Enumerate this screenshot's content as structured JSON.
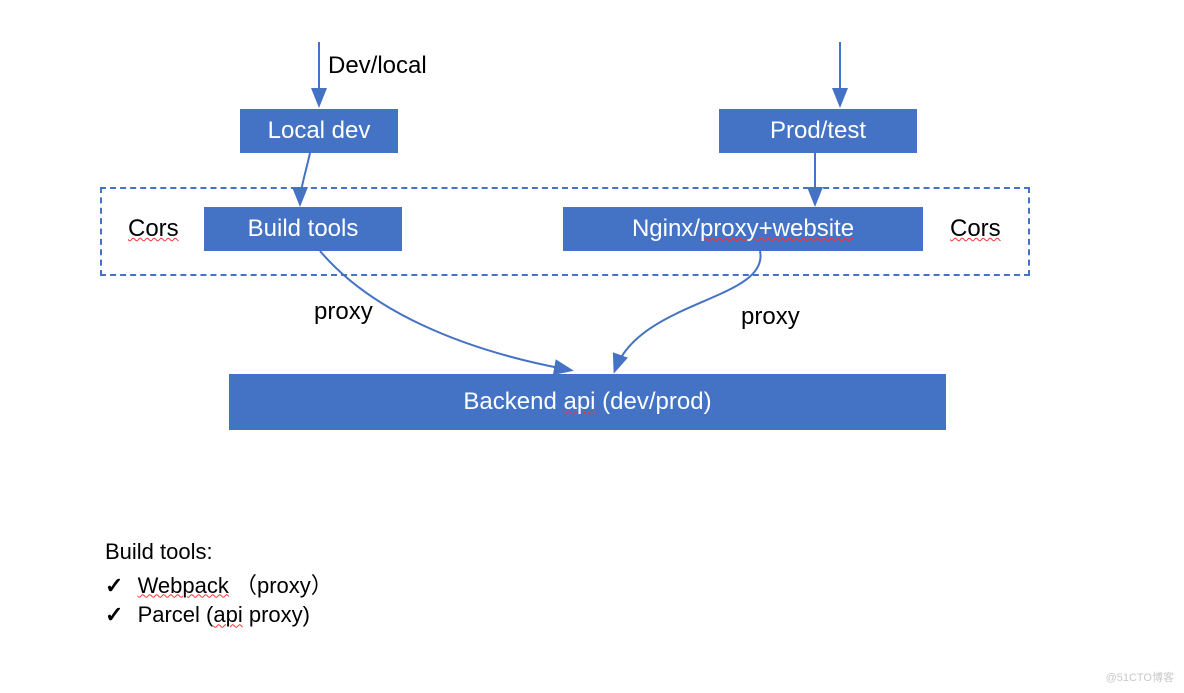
{
  "labels": {
    "dev_local": "Dev/local",
    "cors_left": "Cors",
    "cors_right": "Cors",
    "proxy_left": "proxy",
    "proxy_right": "proxy"
  },
  "boxes": {
    "local_dev": "Local dev",
    "prod_test": "Prod/test",
    "build_tools": "Build tools",
    "nginx_prefix": "Nginx/",
    "nginx_spell": "proxy+website",
    "backend_prefix": "Backend ",
    "backend_spell": "api",
    "backend_suffix": " (dev/prod)"
  },
  "notes": {
    "title": "Build tools:",
    "item1_spell": "Webpack",
    "item1_suffix": " （proxy）",
    "item2_prefix": "Parcel (",
    "item2_spell": "api",
    "item2_suffix": " proxy)"
  },
  "watermark": "@51CTO博客",
  "colors": {
    "box": "#4472C4",
    "arrow": "#4472C4"
  }
}
